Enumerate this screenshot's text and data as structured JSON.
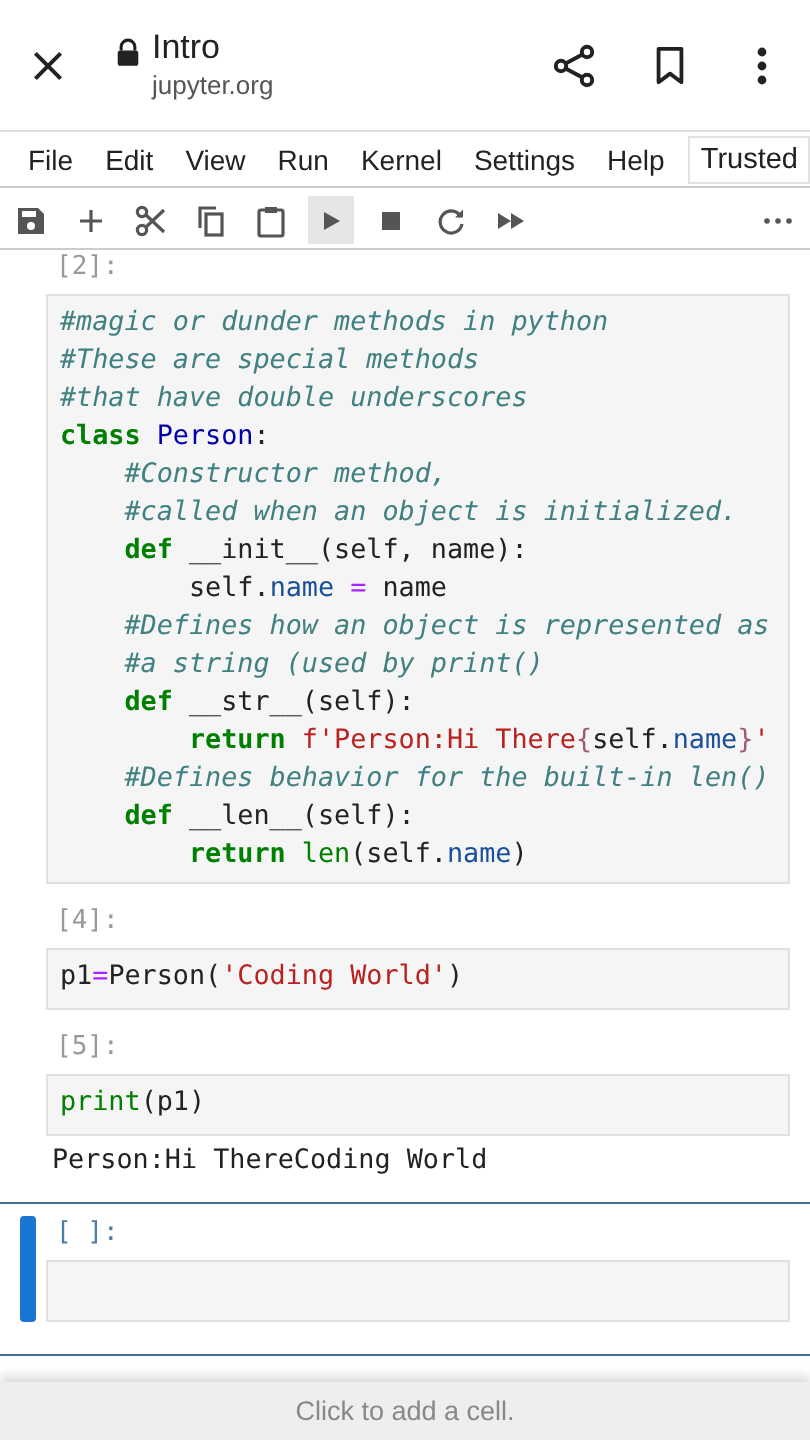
{
  "browser": {
    "title": "Intro",
    "url": "jupyter.org"
  },
  "menu": [
    {
      "label": "File",
      "kind": "item"
    },
    {
      "label": "Edit",
      "kind": "item"
    },
    {
      "label": "View",
      "kind": "item"
    },
    {
      "label": "Run",
      "kind": "item"
    },
    {
      "label": "Kernel",
      "kind": "item"
    },
    {
      "label": "Settings",
      "kind": "item"
    },
    {
      "label": "Help",
      "kind": "item"
    },
    {
      "label": "Trusted",
      "kind": "indicator"
    }
  ],
  "toolbar": [
    {
      "kind": "save",
      "highlighted": false
    },
    {
      "kind": "add",
      "highlighted": false
    },
    {
      "kind": "cut",
      "highlighted": false
    },
    {
      "kind": "copy",
      "highlighted": false
    },
    {
      "kind": "paste",
      "highlighted": false
    },
    {
      "kind": "run",
      "highlighted": true
    },
    {
      "kind": "stop",
      "highlighted": false
    },
    {
      "kind": "restart",
      "highlighted": false
    },
    {
      "kind": "run-all",
      "highlighted": false
    },
    {
      "kind": "more",
      "highlighted": false
    }
  ],
  "cells": [
    {
      "prompt": "[2]:",
      "active": false,
      "lines": [
        [
          {
            "kind": "comment",
            "text": "#magic or dunder methods in python"
          }
        ],
        [
          {
            "kind": "comment",
            "text": "#These are special methods"
          }
        ],
        [
          {
            "kind": "comment",
            "text": "#that have double underscores"
          }
        ],
        [
          {
            "kind": "keyword",
            "text": "class"
          },
          {
            "kind": "classname",
            "text": " Person"
          },
          {
            "kind": "plain",
            "text": ":"
          }
        ],
        [
          {
            "kind": "comment",
            "text": "    #Constructor method,"
          }
        ],
        [
          {
            "kind": "comment",
            "text": "    #called when an object is initialized."
          }
        ],
        [
          {
            "kind": "keyword",
            "text": "    def"
          },
          {
            "kind": "plain",
            "text": " __init__(self, name):"
          }
        ],
        [
          {
            "kind": "plain",
            "text": "        self."
          },
          {
            "kind": "attr",
            "text": "name"
          },
          {
            "kind": "operator",
            "text": " ="
          },
          {
            "kind": "plain",
            "text": " name"
          }
        ],
        [
          {
            "kind": "comment",
            "text": "    #Defines how an object is represented as"
          }
        ],
        [
          {
            "kind": "comment",
            "text": "    #a string (used by print()"
          }
        ],
        [
          {
            "kind": "keyword",
            "text": "    def"
          },
          {
            "kind": "plain",
            "text": " __str__(self):"
          }
        ],
        [
          {
            "kind": "keyword",
            "text": "        return"
          },
          {
            "kind": "string",
            "text": " f'Person:Hi There"
          },
          {
            "kind": "interp",
            "text": "{"
          },
          {
            "kind": "plain",
            "text": "self."
          },
          {
            "kind": "attr",
            "text": "name"
          },
          {
            "kind": "interp",
            "text": "}"
          },
          {
            "kind": "string",
            "text": "'"
          }
        ],
        [
          {
            "kind": "comment",
            "text": "    #Defines behavior for the built-in len()"
          }
        ],
        [
          {
            "kind": "keyword",
            "text": "    def"
          },
          {
            "kind": "plain",
            "text": " __len__(self):"
          }
        ],
        [
          {
            "kind": "keyword",
            "text": "        return"
          },
          {
            "kind": "builtin",
            "text": " len"
          },
          {
            "kind": "plain",
            "text": "(self."
          },
          {
            "kind": "attr",
            "text": "name"
          },
          {
            "kind": "plain",
            "text": ")"
          }
        ]
      ]
    },
    {
      "prompt": "[4]:",
      "active": false,
      "lines": [
        [
          {
            "kind": "plain",
            "text": "p1"
          },
          {
            "kind": "operator",
            "text": "="
          },
          {
            "kind": "plain",
            "text": "Person("
          },
          {
            "kind": "string",
            "text": "'Coding World'"
          },
          {
            "kind": "plain",
            "text": ")"
          }
        ]
      ]
    },
    {
      "prompt": "[5]:",
      "active": false,
      "lines": [
        [
          {
            "kind": "builtin",
            "text": "print"
          },
          {
            "kind": "plain",
            "text": "(p1)"
          }
        ]
      ],
      "output": "Person:Hi ThereCoding World"
    },
    {
      "prompt": "[ ]:",
      "active": true
    }
  ],
  "footer": "Click to add a cell."
}
